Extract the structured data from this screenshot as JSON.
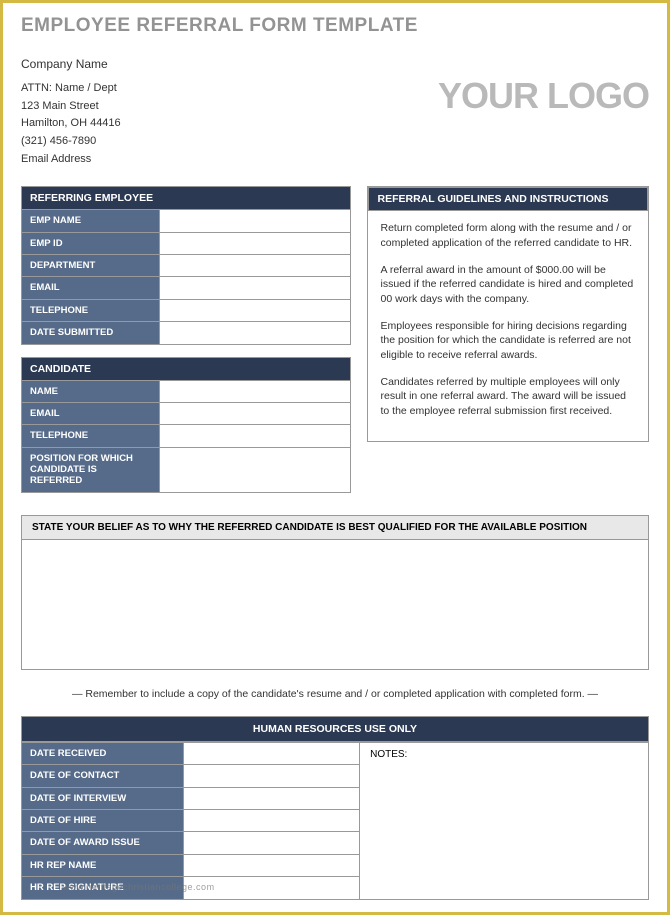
{
  "title": "EMPLOYEE REFERRAL FORM TEMPLATE",
  "company": {
    "name": "Company Name",
    "attn": "ATTN: Name / Dept",
    "street": "123 Main Street",
    "citystate": "Hamilton, OH  44416",
    "phone": "(321) 456-7890",
    "email": "Email Address"
  },
  "logo": "YOUR LOGO",
  "referring": {
    "header": "REFERRING EMPLOYEE",
    "fields": [
      {
        "label": "EMP NAME",
        "value": ""
      },
      {
        "label": "EMP ID",
        "value": ""
      },
      {
        "label": "DEPARTMENT",
        "value": ""
      },
      {
        "label": "EMAIL",
        "value": ""
      },
      {
        "label": "TELEPHONE",
        "value": ""
      },
      {
        "label": "DATE SUBMITTED",
        "value": ""
      }
    ]
  },
  "candidate": {
    "header": "CANDIDATE",
    "fields": [
      {
        "label": "NAME",
        "value": ""
      },
      {
        "label": "EMAIL",
        "value": ""
      },
      {
        "label": "TELEPHONE",
        "value": ""
      },
      {
        "label": "POSITION FOR WHICH CANDIDATE IS REFERRED",
        "value": ""
      }
    ]
  },
  "guidelines": {
    "header": "REFERRAL GUIDELINES AND INSTRUCTIONS",
    "p1": "Return completed form along with the resume and / or completed application of the referred candidate to HR.",
    "p2": "A referral award in the amount of $000.00 will be issued if the referred candidate is hired and completed 00 work days with the company.",
    "p3": "Employees responsible for hiring decisions regarding the position for which the candidate is referred are not eligible to receive referral awards.",
    "p4": "Candidates referred by multiple employees will only result in one referral award.  The award will be issued to the employee referral submission first received."
  },
  "belief": {
    "header": "STATE YOUR BELIEF AS TO WHY THE REFERRED CANDIDATE IS BEST QUALIFIED FOR THE AVAILABLE POSITION"
  },
  "reminder": "— Remember to include a copy of the candidate's resume and / or completed application with completed form. —",
  "hr": {
    "header": "HUMAN RESOURCES USE ONLY",
    "fields": [
      {
        "label": "DATE RECEIVED",
        "value": ""
      },
      {
        "label": "DATE OF CONTACT",
        "value": ""
      },
      {
        "label": "DATE OF INTERVIEW",
        "value": ""
      },
      {
        "label": "DATE OF HIRE",
        "value": ""
      },
      {
        "label": "DATE OF AWARD ISSUE",
        "value": ""
      },
      {
        "label": "HR REP NAME",
        "value": ""
      },
      {
        "label": "HR REP SIGNATURE",
        "value": ""
      }
    ],
    "notes_label": "NOTES:"
  },
  "watermark": "www.heritagechristiancollege.com"
}
